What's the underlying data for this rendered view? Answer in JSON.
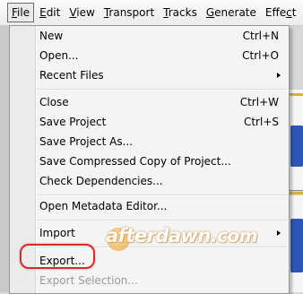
{
  "menubar": {
    "items": [
      {
        "label": "File",
        "ul": "F",
        "rest": "ile"
      },
      {
        "label": "Edit",
        "ul": "E",
        "rest": "dit"
      },
      {
        "label": "View",
        "ul": "V",
        "rest": "iew"
      },
      {
        "label": "Transport",
        "ul": "T",
        "rest": "ransport"
      },
      {
        "label": "Tracks",
        "ul": "T",
        "rest": "racks"
      },
      {
        "label": "Generate",
        "ul": "G",
        "rest": "enerate"
      },
      {
        "label": "Effect",
        "ul": "c",
        "pre": "Effe",
        "post": "t"
      }
    ]
  },
  "file_menu": {
    "new": {
      "label": "New",
      "shortcut": "Ctrl+N"
    },
    "open": {
      "label": "Open...",
      "shortcut": "Ctrl+O"
    },
    "recent": {
      "label": "Recent Files"
    },
    "close": {
      "label": "Close",
      "shortcut": "Ctrl+W"
    },
    "save_project": {
      "label": "Save Project",
      "shortcut": "Ctrl+S"
    },
    "save_project_as": {
      "label": "Save Project As..."
    },
    "save_compressed": {
      "label": "Save Compressed Copy of Project..."
    },
    "check_dependencies": {
      "label": "Check Dependencies..."
    },
    "open_metadata": {
      "label": "Open Metadata Editor..."
    },
    "import": {
      "label": "Import"
    },
    "export": {
      "label": "Export..."
    },
    "export_selection": {
      "label": "Export Selection..."
    }
  },
  "watermark": {
    "brand": "afterdawn",
    "tld": ".com"
  },
  "colors": {
    "highlight": "#d62b2b",
    "waveform": "#2e56b8",
    "watermark_accent": "#e49a2c"
  }
}
